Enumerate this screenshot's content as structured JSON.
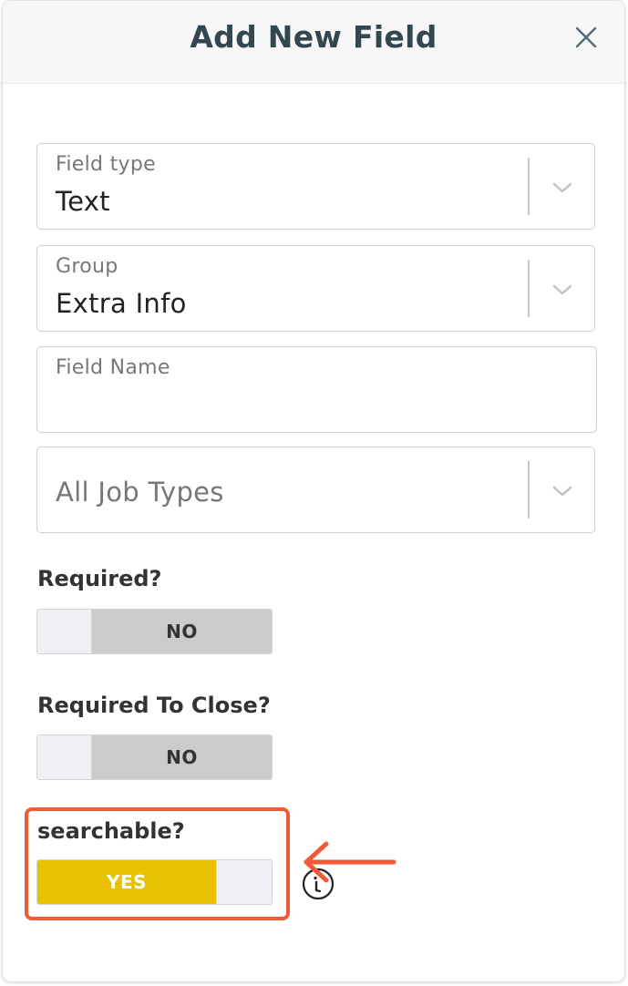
{
  "modal": {
    "title": "Add New Field",
    "close_icon": "close-icon"
  },
  "fields": {
    "field_type": {
      "label": "Field type",
      "value": "Text",
      "icon": "chevron-down-icon"
    },
    "group": {
      "label": "Group",
      "value": "Extra Info",
      "icon": "chevron-down-icon"
    },
    "field_name": {
      "label": "Field Name",
      "value": ""
    },
    "job_types": {
      "placeholder": "All Job Types",
      "icon": "chevron-down-icon"
    }
  },
  "toggles": {
    "required": {
      "label": "Required?",
      "state": "NO"
    },
    "required_to_close": {
      "label": "Required To Close?",
      "state": "NO"
    },
    "searchable": {
      "label": "searchable?",
      "state": "YES",
      "info_icon": "info-icon"
    }
  },
  "annotation": {
    "color": "#f05a38",
    "arrow_icon": "arrow-left-icon"
  },
  "colors": {
    "accent_yes": "#e8c200",
    "toggle_off": "#cbcbcb",
    "title": "#33474f"
  }
}
